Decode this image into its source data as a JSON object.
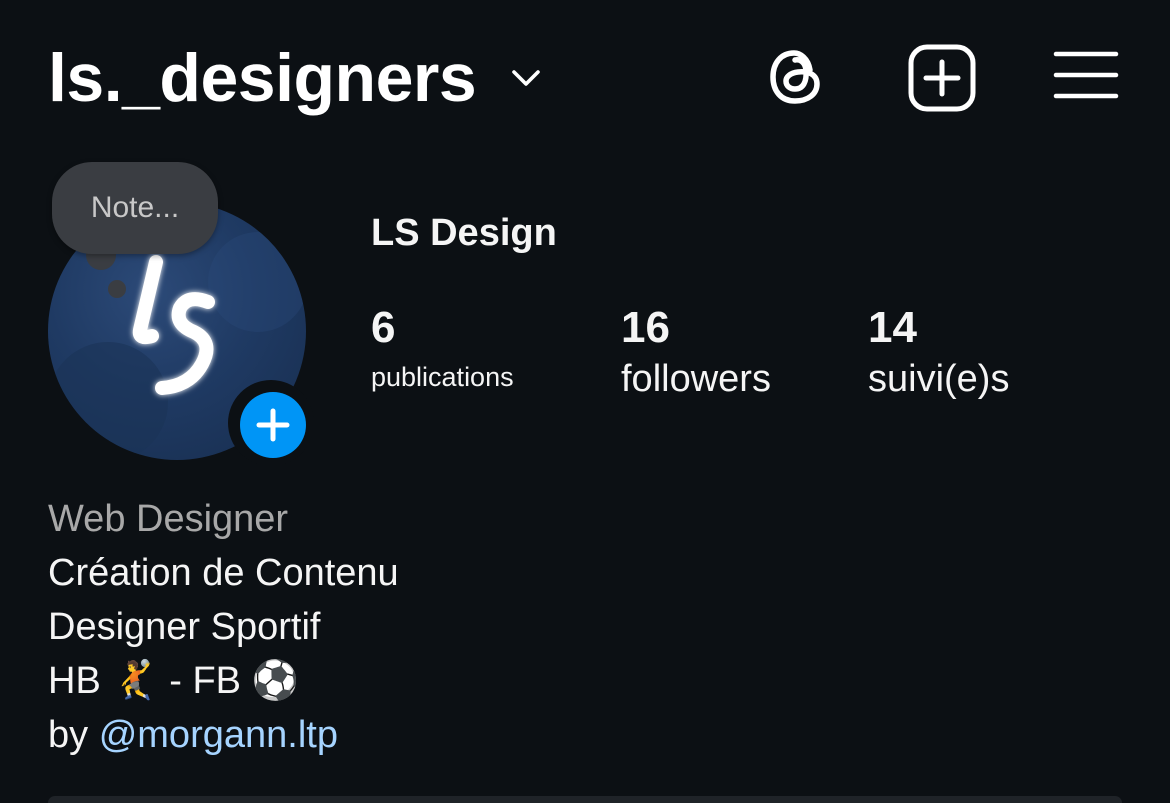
{
  "header": {
    "username": "ls._designers"
  },
  "note": {
    "placeholder": "Note..."
  },
  "profile": {
    "display_name": "LS Design",
    "stats": {
      "posts": {
        "count": "6",
        "label": "publications"
      },
      "followers": {
        "count": "16",
        "label": "followers"
      },
      "following": {
        "count": "14",
        "label": "suivi(e)s"
      }
    }
  },
  "bio": {
    "category": "Web Designer",
    "line1": "Création de Contenu",
    "line2": "Designer Sportif",
    "line3_a": "HB",
    "line3_emoji_1": "🤾",
    "line3_b": " - FB ",
    "line3_emoji_2": "⚽",
    "line4_prefix": "by ",
    "line4_link": "@morgann.ltp"
  },
  "colors": {
    "background": "#0c1014",
    "text": "#f5f5f5",
    "muted": "#a8a8a8",
    "link": "#a6d4ff",
    "accent": "#0095f6"
  },
  "icons": {
    "username_dropdown": "chevron-down-icon",
    "threads": "threads-icon",
    "new_post": "plus-square-icon",
    "menu": "hamburger-menu-icon",
    "add_story": "plus-icon"
  }
}
